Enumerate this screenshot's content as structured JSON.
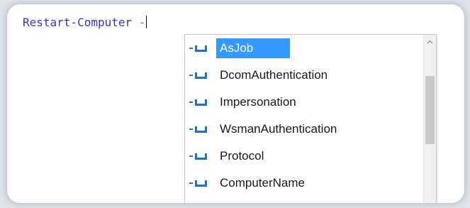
{
  "editor": {
    "cmdlet": "Restart-Computer",
    "typed_param_prefix": "-"
  },
  "completion": {
    "items": [
      {
        "label": "AsJob",
        "selected": true,
        "icon": "parameter-icon"
      },
      {
        "label": "DcomAuthentication",
        "selected": false,
        "icon": "parameter-icon"
      },
      {
        "label": "Impersonation",
        "selected": false,
        "icon": "parameter-icon"
      },
      {
        "label": "WsmanAuthentication",
        "selected": false,
        "icon": "parameter-icon"
      },
      {
        "label": "Protocol",
        "selected": false,
        "icon": "parameter-icon"
      },
      {
        "label": "ComputerName",
        "selected": false,
        "icon": "parameter-icon"
      }
    ]
  },
  "colors": {
    "cmdlet": "#3333d6",
    "selection": "#3399ff",
    "icon": "#1e73c8"
  }
}
